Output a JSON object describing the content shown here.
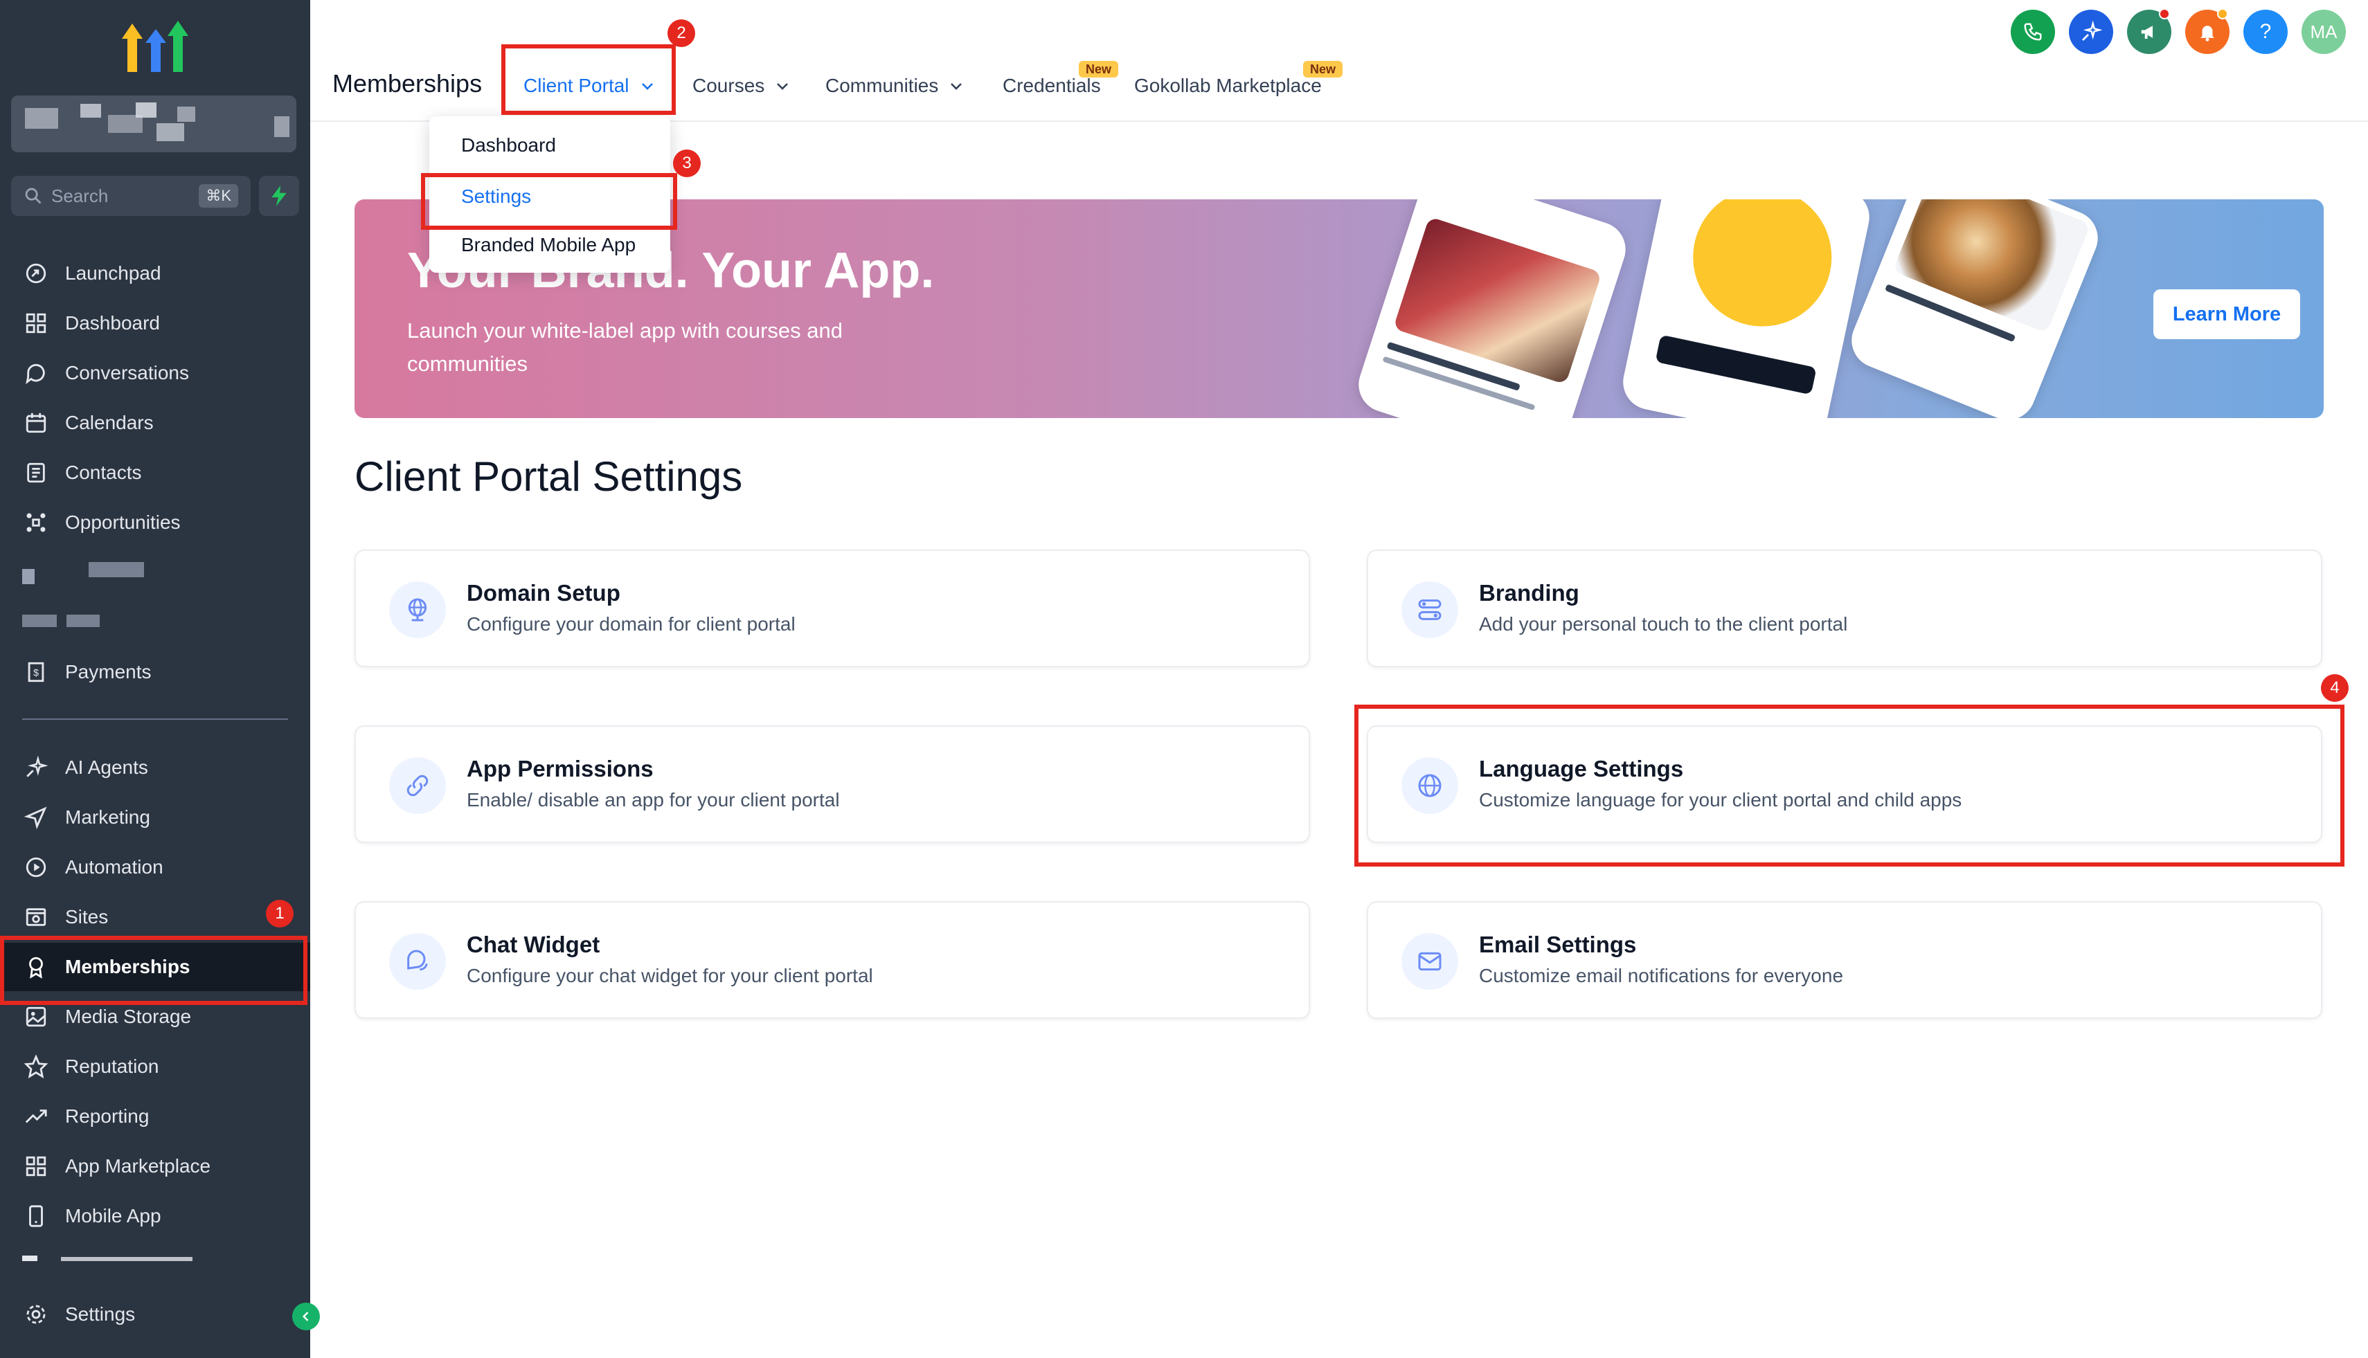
{
  "sidebar": {
    "search_placeholder": "Search",
    "search_shortcut": "⌘K",
    "items": [
      {
        "label": "Launchpad",
        "icon": "launchpad-icon"
      },
      {
        "label": "Dashboard",
        "icon": "dashboard-icon"
      },
      {
        "label": "Conversations",
        "icon": "chat-bubble-icon"
      },
      {
        "label": "Calendars",
        "icon": "calendar-icon"
      },
      {
        "label": "Contacts",
        "icon": "contacts-icon"
      },
      {
        "label": "Opportunities",
        "icon": "opportunities-icon"
      },
      {
        "label": "Payments",
        "icon": "payments-icon"
      },
      {
        "label": "AI Agents",
        "icon": "sparkle-icon"
      },
      {
        "label": "Marketing",
        "icon": "send-icon"
      },
      {
        "label": "Automation",
        "icon": "automation-icon"
      },
      {
        "label": "Sites",
        "icon": "sites-icon"
      },
      {
        "label": "Memberships",
        "icon": "award-icon"
      },
      {
        "label": "Media Storage",
        "icon": "image-icon"
      },
      {
        "label": "Reputation",
        "icon": "star-icon"
      },
      {
        "label": "Reporting",
        "icon": "trend-icon"
      },
      {
        "label": "App Marketplace",
        "icon": "grid-icon"
      },
      {
        "label": "Mobile App",
        "icon": "mobile-icon"
      },
      {
        "label": "Settings",
        "icon": "gear-icon"
      }
    ]
  },
  "annotations": [
    "1",
    "2",
    "3",
    "4"
  ],
  "header": {
    "title": "Memberships",
    "tabs": [
      {
        "label": "Client Portal",
        "active": true
      },
      {
        "label": "Courses"
      },
      {
        "label": "Communities"
      },
      {
        "label": "Credentials",
        "badge": "New"
      },
      {
        "label": "Gokollab Marketplace",
        "badge": "New"
      }
    ],
    "avatar_initials": "MA",
    "help_label": "?"
  },
  "dropdown": {
    "items": [
      {
        "label": "Dashboard"
      },
      {
        "label": "Settings",
        "active": true
      },
      {
        "label": "Branded Mobile App"
      }
    ]
  },
  "banner": {
    "title": "Your Brand. Your App.",
    "subtitle": "Launch your white-label app with courses and communities",
    "cta": "Learn More"
  },
  "page": {
    "heading": "Client Portal Settings",
    "cards": [
      {
        "title": "Domain Setup",
        "description": "Configure your domain for client portal",
        "icon": "globe-pin-icon"
      },
      {
        "title": "Branding",
        "description": "Add your personal touch to the client portal",
        "icon": "sliders-icon"
      },
      {
        "title": "App Permissions",
        "description": "Enable/ disable an app for your client portal",
        "icon": "link-icon"
      },
      {
        "title": "Language Settings",
        "description": "Customize language for your client portal and child apps",
        "icon": "globe-icon"
      },
      {
        "title": "Chat Widget",
        "description": "Configure your chat widget for your client portal",
        "icon": "chat-widget-icon"
      },
      {
        "title": "Email Settings",
        "description": "Customize email notifications for everyone",
        "icon": "mail-icon"
      }
    ]
  },
  "colors": {
    "sidebar_bg": "#2b3441",
    "accent": "#1570ef",
    "annotation_red": "#e5271f"
  }
}
